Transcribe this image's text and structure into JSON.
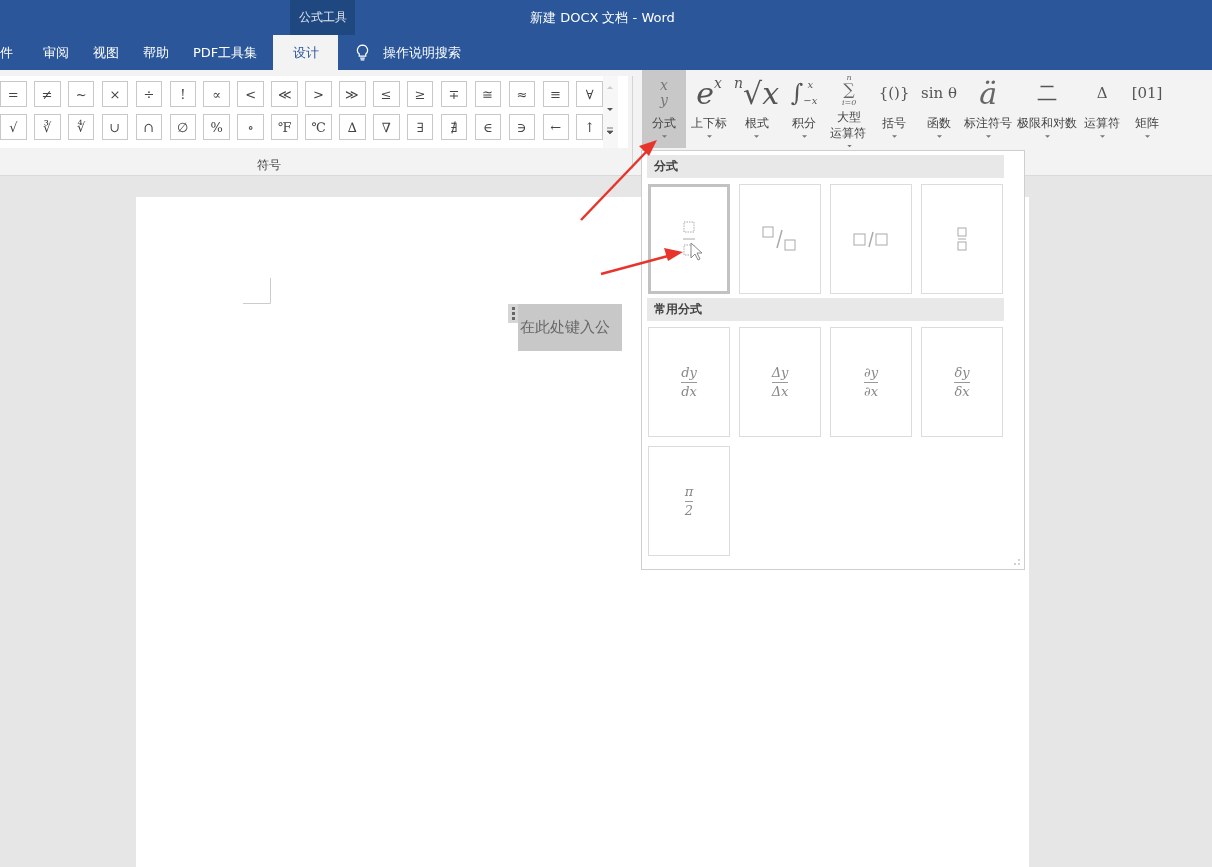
{
  "window": {
    "title": "新建 DOCX 文档  -  Word",
    "context_tab_group": "公式工具"
  },
  "tabs": [
    {
      "label": "件",
      "selected": false
    },
    {
      "label": "审阅",
      "selected": false
    },
    {
      "label": "视图",
      "selected": false
    },
    {
      "label": "帮助",
      "selected": false
    },
    {
      "label": "PDF工具集",
      "selected": false
    },
    {
      "label": "设计",
      "selected": true
    }
  ],
  "tell_me": {
    "placeholder": "操作说明搜索"
  },
  "symbols": {
    "rows": [
      [
        "=",
        "≠",
        "~",
        "×",
        "÷",
        "!",
        "∝",
        "<",
        "≪",
        ">",
        "≫",
        "≤",
        "≥",
        "∓",
        "≅",
        "≈",
        "≡",
        "∀"
      ],
      [
        "√",
        "∛",
        "∜",
        "∪",
        "∩",
        "∅",
        "%",
        "∘",
        "℉",
        "℃",
        "∆",
        "∇",
        "∃",
        "∄",
        "∈",
        "∋",
        "←",
        "↑"
      ]
    ],
    "group_label": "符号"
  },
  "structures": [
    {
      "label": "分式",
      "selected": true,
      "glyph": {
        "kind": "fraction",
        "top": "x",
        "bottom": "y"
      }
    },
    {
      "label": "上下标",
      "selected": false,
      "glyph": {
        "kind": "power",
        "main": "e",
        "sup": "x"
      }
    },
    {
      "label": "根式",
      "selected": false,
      "glyph": {
        "kind": "power",
        "main": "√x",
        "pre": "n"
      }
    },
    {
      "label": "积分",
      "selected": false,
      "glyph": {
        "kind": "limits",
        "main": "∫",
        "sup": "x",
        "sub": "−x"
      }
    },
    {
      "label": "大型运算符",
      "selected": false,
      "glyph": {
        "kind": "stack",
        "main": "∑",
        "sup": "n",
        "sub": "i=0"
      }
    },
    {
      "label": "括号",
      "selected": false,
      "glyph": {
        "kind": "text",
        "main": "{()}"
      }
    },
    {
      "label": "函数",
      "selected": false,
      "glyph": {
        "kind": "text",
        "main": "sin θ"
      }
    },
    {
      "label": "标注符号",
      "selected": false,
      "glyph": {
        "kind": "big",
        "main": "ä"
      }
    },
    {
      "label": "极限和对数",
      "selected": false,
      "glyph": {
        "kind": "none"
      }
    },
    {
      "label": "运算符",
      "selected": false,
      "glyph": {
        "kind": "text",
        "main": "Δ"
      }
    },
    {
      "label": "矩阵",
      "selected": false,
      "glyph": {
        "kind": "text",
        "main": "[01]"
      }
    }
  ],
  "gallery": {
    "sections": [
      {
        "title": "分式",
        "items": [
          {
            "kind": "stacked",
            "selected": true
          },
          {
            "kind": "skewed",
            "selected": false
          },
          {
            "kind": "linear",
            "selected": false
          },
          {
            "kind": "small",
            "selected": false
          }
        ]
      },
      {
        "title": "常用分式",
        "items": [
          {
            "kind": "fraction",
            "selected": false,
            "numerator": "dy",
            "denominator": "dx"
          },
          {
            "kind": "fraction",
            "selected": false,
            "numerator": "Δy",
            "denominator": "Δx"
          },
          {
            "kind": "fraction",
            "selected": false,
            "numerator": "∂y",
            "denominator": "∂x"
          },
          {
            "kind": "fraction",
            "selected": false,
            "numerator": "δy",
            "denominator": "δx"
          },
          {
            "kind": "fraction",
            "selected": false,
            "numerator": "π",
            "denominator": "2"
          }
        ]
      }
    ]
  },
  "document": {
    "equation_placeholder": "在此处键入公"
  }
}
